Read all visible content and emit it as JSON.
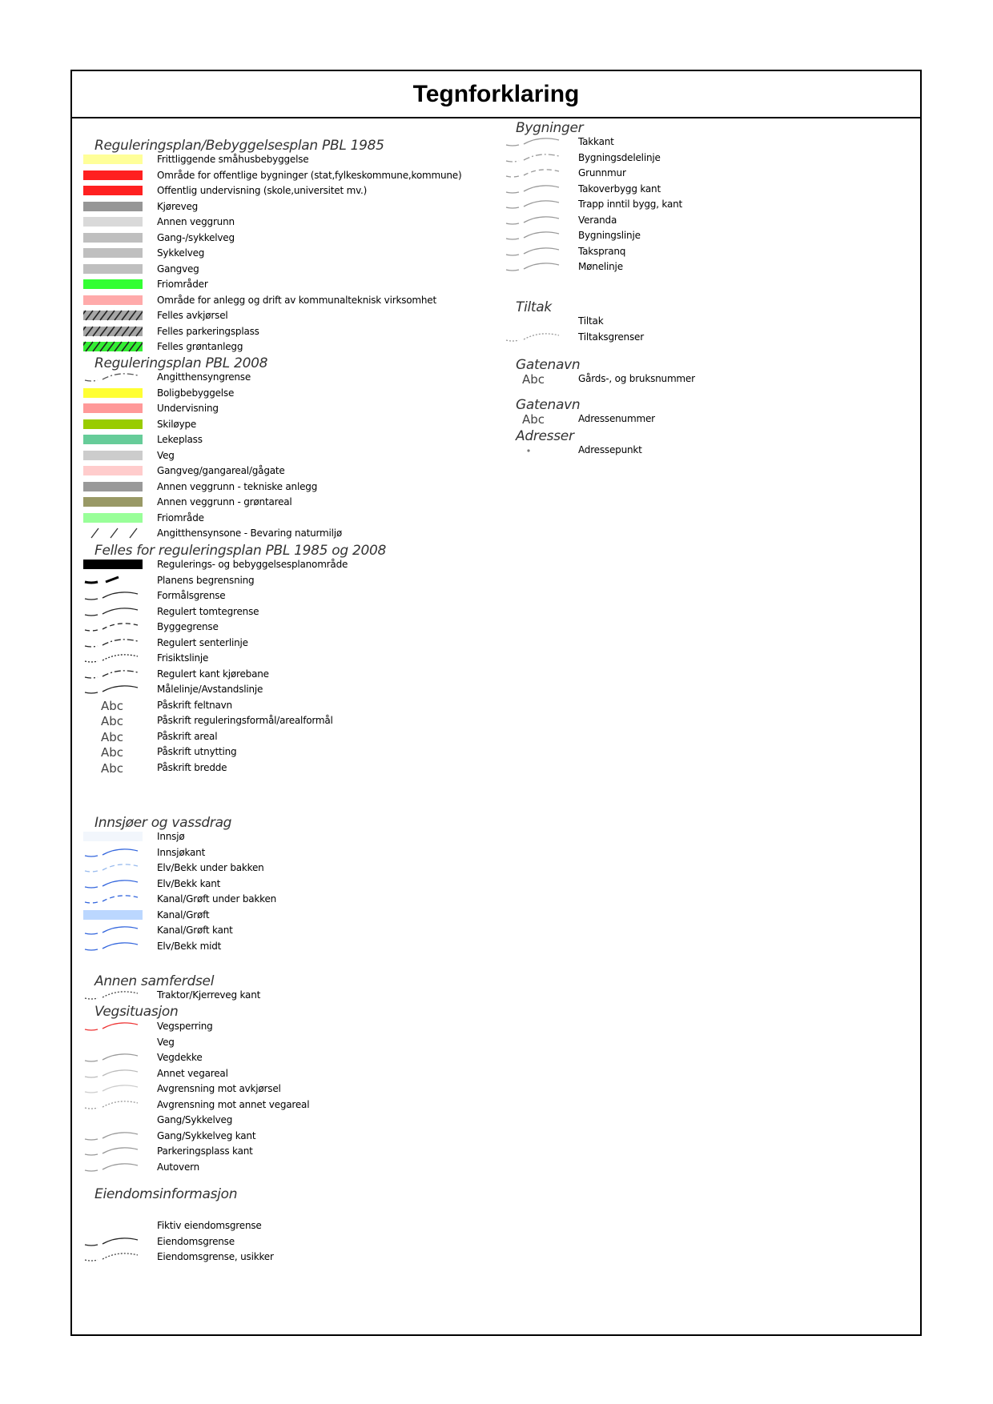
{
  "title": "Tegnforklaring",
  "left_column": [
    {
      "heading": "Reguleringsplan/Bebyggelsesplan PBL 1985",
      "items": [
        {
          "label": "Frittliggende småhusbebyggelse",
          "symbol": "fill",
          "color": "#ffff99"
        },
        {
          "label": "Område for offentlige bygninger (stat,fylkeskommune,kommune)",
          "symbol": "fill",
          "color": "#ff2020"
        },
        {
          "label": "Offentlig undervisning (skole,universitet mv.)",
          "symbol": "fill",
          "color": "#ff2020"
        },
        {
          "label": "Kjøreveg",
          "symbol": "fill",
          "color": "#969696"
        },
        {
          "label": "Annen veggrunn",
          "symbol": "fill",
          "color": "#d9d9d9"
        },
        {
          "label": "Gang-/sykkelveg",
          "symbol": "fill",
          "color": "#bfbfbf"
        },
        {
          "label": "Sykkelveg",
          "symbol": "fill",
          "color": "#bfbfbf"
        },
        {
          "label": "Gangveg",
          "symbol": "fill",
          "color": "#bfbfbf"
        },
        {
          "label": "Friområder",
          "symbol": "fill",
          "color": "#33ff33"
        },
        {
          "label": "Område for anlegg og drift av kommunalteknisk virksomhet",
          "symbol": "fill",
          "color": "#ffaaaa"
        },
        {
          "label": "Felles avkjørsel",
          "symbol": "hatch",
          "color": "#a6a6a6"
        },
        {
          "label": "Felles parkeringsplass",
          "symbol": "hatch",
          "color": "#a6a6a6"
        },
        {
          "label": "Felles grøntanlegg",
          "symbol": "hatch",
          "color": "#33ee33"
        }
      ]
    },
    {
      "heading": "Reguleringsplan   PBL  2008",
      "items": [
        {
          "label": "Angitthensyngrense",
          "symbol": "dashdot",
          "color": "#555555"
        },
        {
          "label": "Boligbebyggelse",
          "symbol": "fill",
          "color": "#ffff33"
        },
        {
          "label": "Undervisning",
          "symbol": "fill",
          "color": "#ff9999"
        },
        {
          "label": "Skiløype",
          "symbol": "fill",
          "color": "#99cc00"
        },
        {
          "label": "Lekeplass",
          "symbol": "fill",
          "color": "#66cc99"
        },
        {
          "label": "Veg",
          "symbol": "fill",
          "color": "#cccccc"
        },
        {
          "label": "Gangveg/gangareal/gågate",
          "symbol": "fill",
          "color": "#ffcccc"
        },
        {
          "label": "Annen veggrunn - tekniske anlegg",
          "symbol": "fill",
          "color": "#999999"
        },
        {
          "label": "Annen veggrunn - grøntareal",
          "symbol": "fill",
          "color": "#999966"
        },
        {
          "label": "Friområde",
          "symbol": "fill",
          "color": "#99ff99"
        },
        {
          "label": "Angitthensynsone - Bevaring naturmiljø",
          "symbol": "slashes",
          "color": "#333333"
        }
      ]
    },
    {
      "heading": "Felles for  reguleringsplan PBL 1985 og 2008",
      "items": [
        {
          "label": "Regulerings- og bebyggelsesplanområde",
          "symbol": "fill",
          "color": "#000000"
        },
        {
          "label": "Planens begrensning",
          "symbol": "thickdash",
          "color": "#000000"
        },
        {
          "label": "Formålsgrense",
          "symbol": "curve",
          "color": "#222222"
        },
        {
          "label": "Regulert tomtegrense",
          "symbol": "curve",
          "color": "#222222"
        },
        {
          "label": "Byggegrense",
          "symbol": "dashed",
          "color": "#222222"
        },
        {
          "label": "Regulert senterlinje",
          "symbol": "dashdot",
          "color": "#222222"
        },
        {
          "label": "Frisiktslinje",
          "symbol": "dotted",
          "color": "#222222"
        },
        {
          "label": "Regulert kant kjørebane",
          "symbol": "dashdot",
          "color": "#222222"
        },
        {
          "label": "Målelinje/Avstandslinje",
          "symbol": "curve",
          "color": "#222222"
        },
        {
          "label": "Påskrift feltnavn",
          "symbol": "abc",
          "text": "Abc"
        },
        {
          "label": "Påskrift reguleringsformål/arealformål",
          "symbol": "abc",
          "text": "Abc"
        },
        {
          "label": "Påskrift areal",
          "symbol": "abc",
          "text": "Abc"
        },
        {
          "label": "Påskrift utnytting",
          "symbol": "abc",
          "text": "Abc"
        },
        {
          "label": "Påskrift bredde",
          "symbol": "abc",
          "text": "Abc"
        }
      ]
    },
    {
      "heading": "Innsjøer og vassdrag",
      "items": [
        {
          "label": "Innsjø",
          "symbol": "fill",
          "color": "#f2f6fc"
        },
        {
          "label": "Innsjøkant",
          "symbol": "curve",
          "color": "#3366dd"
        },
        {
          "label": "Elv/Bekk under bakken",
          "symbol": "dashed",
          "color": "#99bbee"
        },
        {
          "label": "Elv/Bekk kant",
          "symbol": "curve",
          "color": "#3366dd"
        },
        {
          "label": "Kanal/Grøft under bakken",
          "symbol": "dashed",
          "color": "#3366dd"
        },
        {
          "label": "Kanal/Grøft",
          "symbol": "fill",
          "color": "#bbd7ff"
        },
        {
          "label": "Kanal/Grøft kant",
          "symbol": "curve",
          "color": "#3366dd"
        },
        {
          "label": "Elv/Bekk midt",
          "symbol": "curve",
          "color": "#3366dd"
        }
      ]
    },
    {
      "heading": "Annen samferdsel",
      "items": [
        {
          "label": "Traktor/Kjerreveg kant",
          "symbol": "dotted",
          "color": "#444444"
        }
      ]
    },
    {
      "heading": "Vegsituasjon",
      "items": [
        {
          "label": "Vegsperring",
          "symbol": "curve",
          "color": "#ee3333"
        },
        {
          "label": "Veg",
          "symbol": "none"
        },
        {
          "label": "Vegdekke",
          "symbol": "curve",
          "color": "#999999"
        },
        {
          "label": "Annet vegareal",
          "symbol": "curve",
          "color": "#bbbbbb"
        },
        {
          "label": "Avgrensning mot avkjørsel",
          "symbol": "curve",
          "color": "#cccccc"
        },
        {
          "label": "Avgrensning mot annet vegareal",
          "symbol": "dotted",
          "color": "#999999"
        },
        {
          "label": "Gang/Sykkelveg",
          "symbol": "none"
        },
        {
          "label": "Gang/Sykkelveg kant",
          "symbol": "curve",
          "color": "#999999"
        },
        {
          "label": "Parkeringsplass kant",
          "symbol": "curve",
          "color": "#999999"
        },
        {
          "label": "Autovern",
          "symbol": "curve",
          "color": "#999999"
        }
      ]
    },
    {
      "heading": "Eiendomsinformasjon",
      "items": [
        {
          "label": "Fiktiv eiendomsgrense",
          "symbol": "none"
        },
        {
          "label": "Eiendomsgrense",
          "symbol": "curve",
          "color": "#222222"
        },
        {
          "label": "Eiendomsgrense, usikker",
          "symbol": "dotted",
          "color": "#444444"
        }
      ]
    }
  ],
  "right_column": [
    {
      "heading": "Bygninger",
      "items": [
        {
          "label": "Takkant",
          "symbol": "curve",
          "color": "#999999"
        },
        {
          "label": "Bygningsdelelinje",
          "symbol": "dashdot",
          "color": "#999999"
        },
        {
          "label": "Grunnmur",
          "symbol": "dashed",
          "color": "#999999"
        },
        {
          "label": "Takoverbygg kant",
          "symbol": "curve",
          "color": "#999999"
        },
        {
          "label": "Trapp inntil bygg, kant",
          "symbol": "curve",
          "color": "#999999"
        },
        {
          "label": "Veranda",
          "symbol": "curve",
          "color": "#999999"
        },
        {
          "label": "Bygningslinje",
          "symbol": "curve",
          "color": "#999999"
        },
        {
          "label": "Takspranq",
          "symbol": "curve",
          "color": "#999999"
        },
        {
          "label": "Mønelinje",
          "symbol": "curve",
          "color": "#999999"
        }
      ]
    },
    {
      "heading": "Tiltak",
      "items": [
        {
          "label": "Tiltak",
          "symbol": "none"
        },
        {
          "label": "Tiltaksgrenser",
          "symbol": "dotted",
          "color": "#999999"
        }
      ]
    },
    {
      "heading": "Gatenavn",
      "items": [
        {
          "label": "Gårds-, og bruksnummer",
          "symbol": "abc",
          "text": "Abc"
        }
      ]
    },
    {
      "heading": "Gatenavn",
      "items": [
        {
          "label": "Adressenummer",
          "symbol": "abc",
          "text": "Abc"
        }
      ]
    },
    {
      "heading": "Adresser",
      "items": [
        {
          "label": "Adressepunkt",
          "symbol": "dot",
          "color": "#777777"
        }
      ]
    }
  ]
}
